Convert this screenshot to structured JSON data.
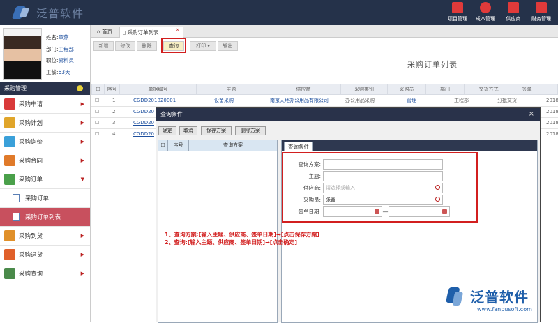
{
  "app": {
    "logo_text": "泛普软件"
  },
  "topnav": [
    {
      "label": "项目管理",
      "icon": "building-icon"
    },
    {
      "label": "成本管理",
      "icon": "pie-chart-icon"
    },
    {
      "label": "供应商",
      "icon": "supplier-icon"
    },
    {
      "label": "财务管理",
      "icon": "finance-icon"
    }
  ],
  "profile": {
    "name_label": "姓名:",
    "name": "章燕",
    "dept_label": "部门:",
    "dept": "工程部",
    "title_label": "职位:",
    "title": "资料员",
    "id_label": "工龄:",
    "id": "63天"
  },
  "sidebar": {
    "header": "采购管理",
    "items": [
      {
        "label": "采购申请",
        "color": "#d93a3a"
      },
      {
        "label": "采购计划",
        "color": "#e0a52a"
      },
      {
        "label": "采购询价",
        "color": "#3aa0d9"
      },
      {
        "label": "采购合同",
        "color": "#e07a2a"
      },
      {
        "label": "采购订单",
        "color": "#4aa04a"
      },
      {
        "label": "采购到货",
        "color": "#e0902a"
      },
      {
        "label": "采购退货",
        "color": "#e0602a"
      },
      {
        "label": "采购查询",
        "color": "#4a8a4a"
      }
    ],
    "subitems": [
      "采购订单",
      "采购订单列表"
    ]
  },
  "tabs": {
    "home": "首页",
    "current": "采购订单列表"
  },
  "toolbar": [
    "新增",
    "修改",
    "删除",
    "查询",
    "打印",
    "输出"
  ],
  "page_title": "采购订单列表",
  "grid": {
    "columns": [
      "序号",
      "单据编号",
      "主题",
      "供应商",
      "采购类别",
      "采购员",
      "部门",
      "交货方式",
      "签单"
    ],
    "rows": [
      {
        "no": "1",
        "code": "CGDD201820001",
        "subject": "设备采购",
        "supplier": "南京天地办公用品有限公司",
        "type": "办公用品采购",
        "buyer": "管理",
        "dept": "工程部",
        "delivery": "分批交货",
        "sign": "2018"
      },
      {
        "no": "2",
        "code": "CGDD20",
        "sign": "2018"
      },
      {
        "no": "3",
        "code": "CGDD20",
        "sign": "2018"
      },
      {
        "no": "4",
        "code": "CGDD20",
        "sign": "2018"
      }
    ]
  },
  "dialog": {
    "title": "查询条件",
    "buttons": [
      "确定",
      "取消",
      "保存方案",
      "删除方案"
    ],
    "left_cols": [
      "序号",
      "查询方案"
    ],
    "right_tab": "查询条件",
    "fields": {
      "scheme_label": "查询方案:",
      "scheme_value": "",
      "subject_label": "主题:",
      "subject_value": "",
      "supplier_label": "供应商:",
      "supplier_placeholder": "请选择或输入",
      "buyer_label": "采购员:",
      "buyer_value": "张鑫",
      "date_label": "签单日期:",
      "date_sep": "—"
    }
  },
  "notes": [
    "1、查询方案:[输入主题、供应商、签单日期]→[点击保存方案]",
    "2、查询:[输入主题、供应商、签单日期]→[点击确定]"
  ],
  "brand": {
    "name": "泛普软件",
    "url": "www.fanpusoft.com"
  },
  "colors": {
    "topbar": "#25324a",
    "highlight": "#d21f1f",
    "active_menu": "#c8505e"
  }
}
